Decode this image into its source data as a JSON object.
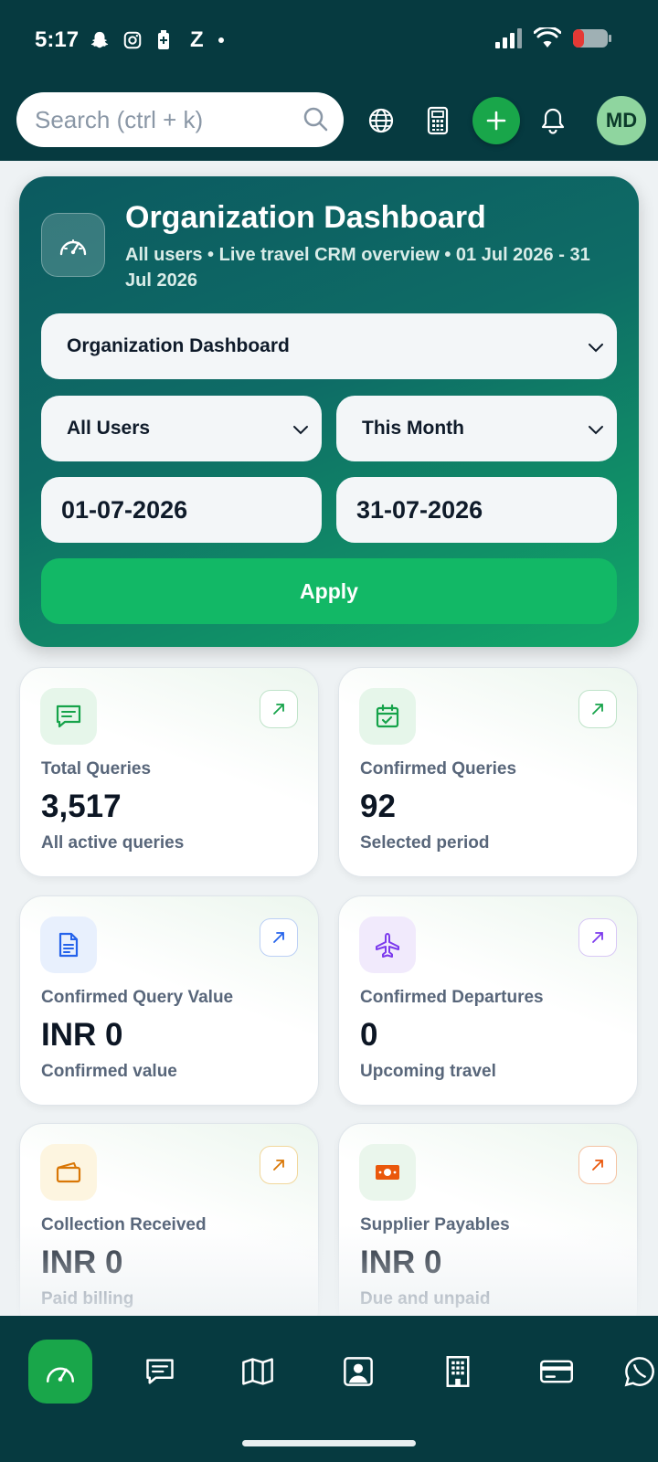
{
  "status": {
    "time": "5:17",
    "app_icons": [
      "snapchat-icon",
      "instagram-icon",
      "battery-saver-icon",
      "z-app-icon",
      "dot-icon"
    ],
    "z_label": "Z"
  },
  "header": {
    "search_placeholder": "Search (ctrl + k)",
    "avatar_initials": "MD"
  },
  "hero": {
    "title": "Organization Dashboard",
    "subtitle": "All users • Live travel CRM overview • 01 Jul 2026 - 31 Jul 2026",
    "dashboard_select": "Organization Dashboard",
    "users_select": "All Users",
    "period_select": "This Month",
    "date_from": "01-07-2026",
    "date_to": "31-07-2026",
    "apply_label": "Apply"
  },
  "cards": [
    {
      "label": "Total Queries",
      "value": "3,517",
      "note": "All active queries",
      "icon": "chat-icon",
      "accent": "#16a34a"
    },
    {
      "label": "Confirmed Queries",
      "value": "92",
      "note": "Selected period",
      "icon": "calendar-check-icon",
      "accent": "#16a34a"
    },
    {
      "label": "Confirmed Query Value",
      "value": "INR 0",
      "note": "Confirmed value",
      "icon": "document-icon",
      "accent": "#2563eb"
    },
    {
      "label": "Confirmed Departures",
      "value": "0",
      "note": "Upcoming travel",
      "icon": "airplane-icon",
      "accent": "#7c3aed"
    },
    {
      "label": "Collection Received",
      "value": "INR 0",
      "note": "Paid billing",
      "icon": "wallet-icon",
      "accent": "#d97706"
    },
    {
      "label": "Supplier Payables",
      "value": "INR 0",
      "note": "Due and unpaid",
      "icon": "cash-icon",
      "accent": "#ea580c"
    }
  ],
  "bottom_nav": [
    "dashboard-icon",
    "chat-icon",
    "map-icon",
    "contact-icon",
    "building-icon",
    "card-icon",
    "whatsapp-icon"
  ],
  "colors": {
    "header_bg": "#063a40",
    "primary_green": "#19a64a",
    "apply_green": "#12b866"
  }
}
